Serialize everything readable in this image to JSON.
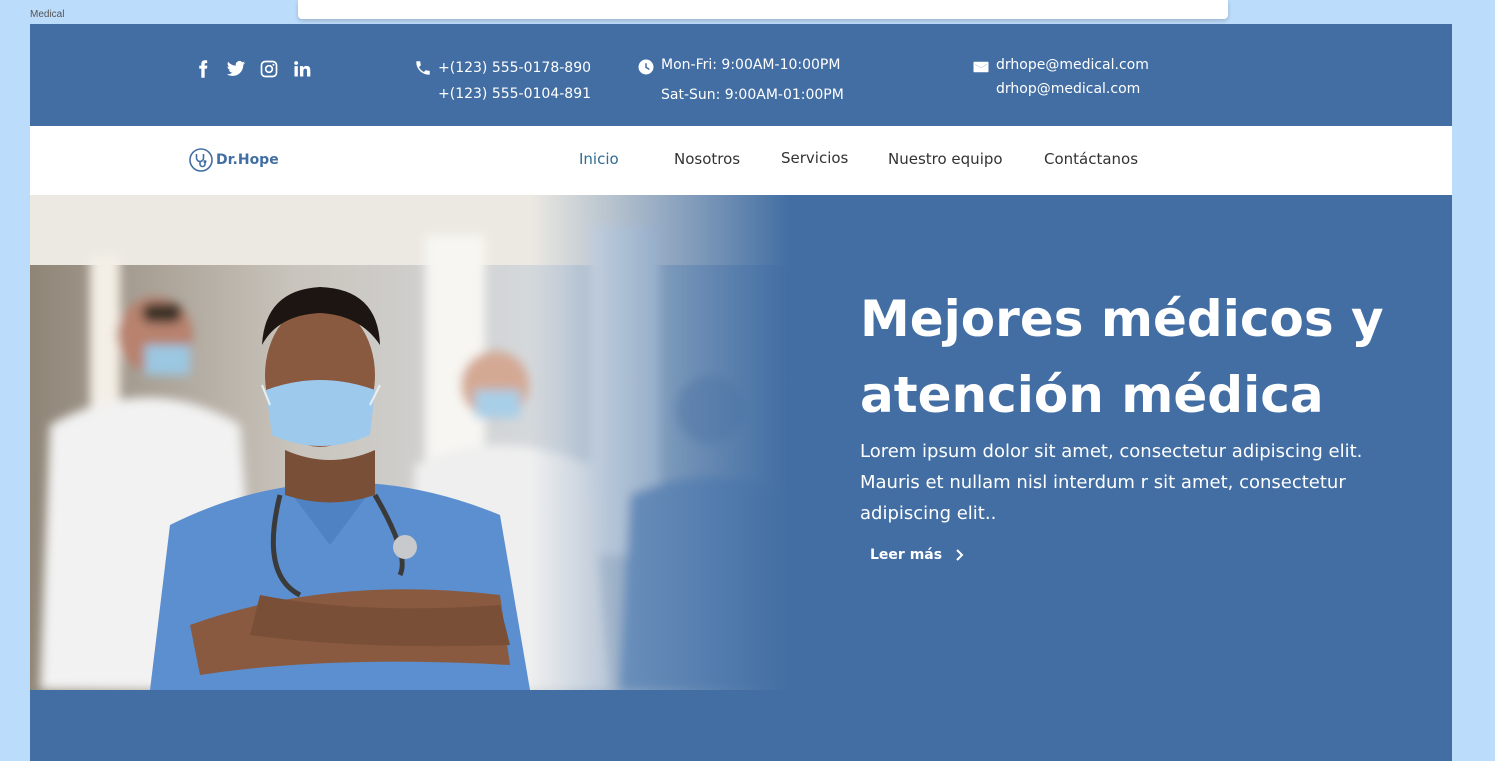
{
  "frame_label": "Medical",
  "topbar": {
    "social_icons": [
      "facebook-icon",
      "twitter-icon",
      "instagram-icon",
      "linkedin-icon"
    ],
    "phone": {
      "icon": "phone-icon",
      "line1": "+(123) 555-0178-890",
      "line2": "+(123) 555-0104-891"
    },
    "hours": {
      "icon": "clock-icon",
      "line1": "Mon-Fri: 9:00AM-10:00PM",
      "line2": "Sat-Sun: 9:00AM-01:00PM"
    },
    "email": {
      "icon": "mail-icon",
      "line1": "drhope@medical.com",
      "line2": "drhop@medical.com"
    }
  },
  "navbar": {
    "logo_text": "Dr.Hope",
    "links": [
      "Inicio",
      "Nosotros",
      "Servicios",
      "Nuestro equipo",
      "Contáctanos"
    ]
  },
  "hero": {
    "title": "Mejores médicos y atención médica",
    "text": "Lorem ipsum dolor sit amet, consectetur adipiscing elit. Mauris et nullam nisl interdum r sit amet, consectetur adipiscing elit..",
    "cta_label": "Leer más"
  },
  "colors": {
    "primary": "#426ea3",
    "page_bg": "#bcdcfb",
    "nav_active": "#2f6b96"
  }
}
